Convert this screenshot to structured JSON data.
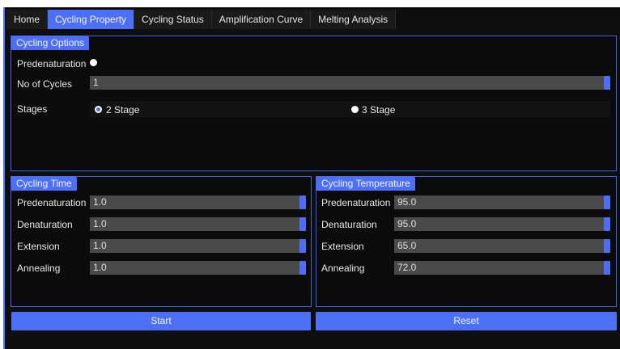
{
  "tabs": [
    {
      "label": "Home",
      "active": false
    },
    {
      "label": "Cycling Property",
      "active": true
    },
    {
      "label": "Cycling Status",
      "active": false
    },
    {
      "label": "Amplification Curve",
      "active": false
    },
    {
      "label": "Melting Analysis",
      "active": false
    }
  ],
  "cycling_options": {
    "title": "Cycling Options",
    "predenaturation_label": "Predenaturation",
    "predenaturation_checked": false,
    "no_of_cycles_label": "No of Cycles",
    "no_of_cycles_value": "1",
    "stages_label": "Stages",
    "stage_options": [
      {
        "label": "2 Stage",
        "selected": true
      },
      {
        "label": "3 Stage",
        "selected": false
      }
    ]
  },
  "cycling_time": {
    "title": "Cycling Time",
    "rows": [
      {
        "label": "Predenaturation",
        "value": "1.0"
      },
      {
        "label": "Denaturation",
        "value": "1.0"
      },
      {
        "label": "Extension",
        "value": "1.0"
      },
      {
        "label": "Annealing",
        "value": "1.0"
      }
    ]
  },
  "cycling_temperature": {
    "title": "Cycling Temperature",
    "rows": [
      {
        "label": "Predenaturation",
        "value": "95.0"
      },
      {
        "label": "Denaturation",
        "value": "95.0"
      },
      {
        "label": "Extension",
        "value": "65.0"
      },
      {
        "label": "Annealing",
        "value": "72.0"
      }
    ]
  },
  "actions": {
    "start_label": "Start",
    "reset_label": "Reset"
  },
  "colors": {
    "accent": "#4d6ff7",
    "background": "#0e0e0e",
    "field": "#4a4a4a"
  }
}
